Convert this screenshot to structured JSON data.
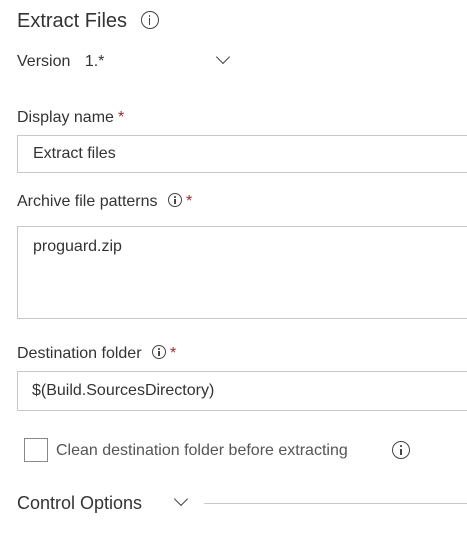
{
  "header": {
    "title": "Extract Files",
    "info_icon": "info-icon"
  },
  "version": {
    "label": "Version",
    "value": "1.*",
    "dropdown_icon": "chevron-down-icon"
  },
  "fields": {
    "display_name": {
      "label": "Display name",
      "required_mark": "*",
      "value": "Extract files"
    },
    "archive_patterns": {
      "label": "Archive file patterns",
      "required_mark": "*",
      "value": "proguard.zip"
    },
    "destination_folder": {
      "label": "Destination folder",
      "required_mark": "*",
      "value": "$(Build.SourcesDirectory)"
    }
  },
  "clean_destination": {
    "label": "Clean destination folder before extracting",
    "checked": false
  },
  "control_options": {
    "label": "Control Options",
    "expand_icon": "chevron-down-icon"
  },
  "colors": {
    "text": "#333333",
    "required": "#a4262c",
    "border": "#c8c8c8"
  }
}
